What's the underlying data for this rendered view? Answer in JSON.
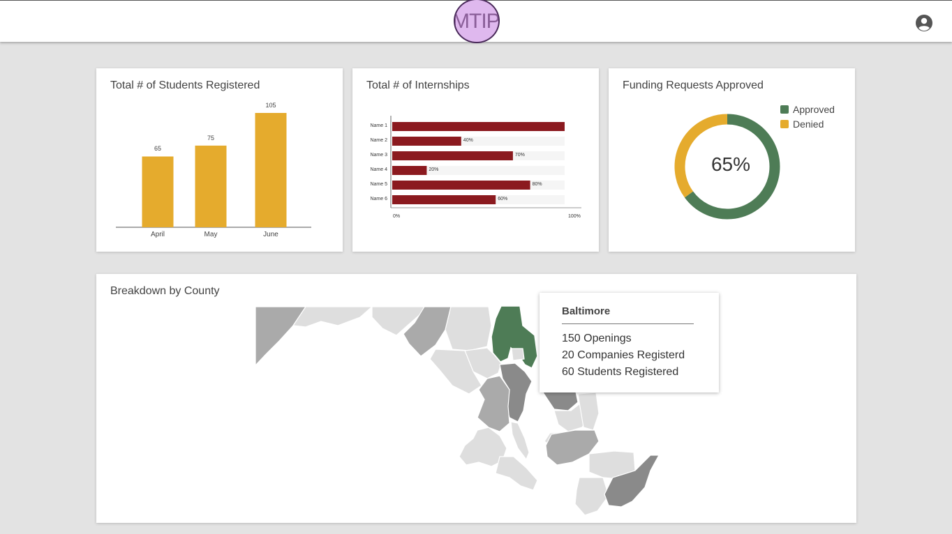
{
  "header": {
    "logo_text": "MTIP",
    "account_icon": "account-circle-icon"
  },
  "students": {
    "title": "Total # of Students Registered",
    "chart_data": {
      "type": "bar",
      "categories": [
        "April",
        "May",
        "June"
      ],
      "values": [
        65,
        75,
        105
      ],
      "data_labels": [
        "65",
        "75",
        "105"
      ],
      "color": "#e5ab2d"
    }
  },
  "internships": {
    "title": "Total # of Internships",
    "chart_data": {
      "type": "bar",
      "orientation": "horizontal",
      "categories": [
        "Name 1",
        "Name 2",
        "Name 3",
        "Name 4",
        "Name 5",
        "Name 6"
      ],
      "values": [
        100,
        40,
        70,
        20,
        80,
        60
      ],
      "data_labels": [
        "",
        "40%",
        "70%",
        "20%",
        "80%",
        "60%"
      ],
      "axis_ticks": [
        "0%",
        "100%"
      ],
      "xlim": [
        0,
        100
      ],
      "color": "#8b1a1f",
      "track_color": "#f5f5f5"
    }
  },
  "funding": {
    "title": "Funding Requests Approved",
    "center_label": "65%",
    "chart_data": {
      "type": "pie",
      "donut": true,
      "labels": [
        "Approved",
        "Denied"
      ],
      "values": [
        65,
        35
      ],
      "colors": [
        "#4e7c56",
        "#e5ab2d"
      ],
      "legend_position": "top-right"
    }
  },
  "county": {
    "title": "Breakdown by County",
    "highlight_color": "#4e7c56",
    "tooltip": {
      "title": "Baltimore",
      "lines": [
        "150 Openings",
        "20 Companies Registerd",
        "60 Students Registered"
      ]
    }
  }
}
